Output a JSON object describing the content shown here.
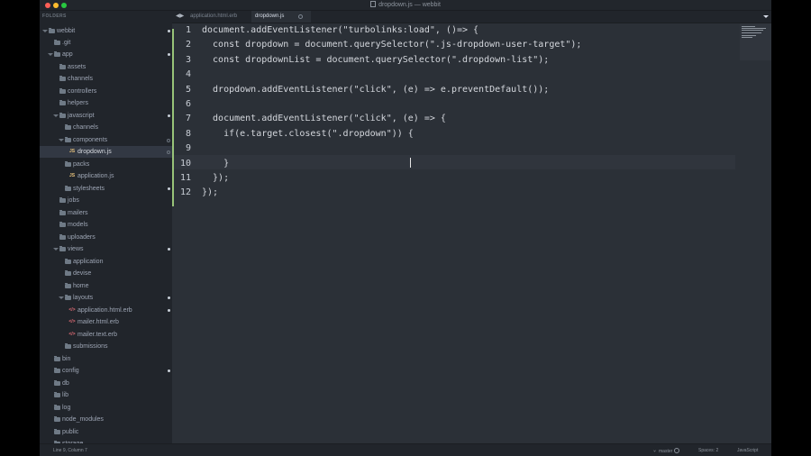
{
  "window": {
    "title": "dropdown.js — webbit"
  },
  "sidebar": {
    "header": "FOLDERS",
    "items": [
      {
        "label": "webbit",
        "type": "folder"
      },
      {
        "label": ".git",
        "type": "folder"
      },
      {
        "label": "app",
        "type": "folder"
      },
      {
        "label": "assets",
        "type": "folder"
      },
      {
        "label": "channels",
        "type": "folder"
      },
      {
        "label": "controllers",
        "type": "folder"
      },
      {
        "label": "helpers",
        "type": "folder"
      },
      {
        "label": "javascript",
        "type": "folder"
      },
      {
        "label": "channels",
        "type": "folder"
      },
      {
        "label": "components",
        "type": "folder"
      },
      {
        "label": "dropdown.js",
        "type": "js"
      },
      {
        "label": "packs",
        "type": "folder"
      },
      {
        "label": "application.js",
        "type": "js"
      },
      {
        "label": "stylesheets",
        "type": "folder"
      },
      {
        "label": "jobs",
        "type": "folder"
      },
      {
        "label": "mailers",
        "type": "folder"
      },
      {
        "label": "models",
        "type": "folder"
      },
      {
        "label": "uploaders",
        "type": "folder"
      },
      {
        "label": "views",
        "type": "folder"
      },
      {
        "label": "application",
        "type": "folder"
      },
      {
        "label": "devise",
        "type": "folder"
      },
      {
        "label": "home",
        "type": "folder"
      },
      {
        "label": "layouts",
        "type": "folder"
      },
      {
        "label": "application.html.erb",
        "type": "erb"
      },
      {
        "label": "mailer.html.erb",
        "type": "erb"
      },
      {
        "label": "mailer.text.erb",
        "type": "erb"
      },
      {
        "label": "submissions",
        "type": "folder"
      },
      {
        "label": "bin",
        "type": "folder"
      },
      {
        "label": "config",
        "type": "folder"
      },
      {
        "label": "db",
        "type": "folder"
      },
      {
        "label": "lib",
        "type": "folder"
      },
      {
        "label": "log",
        "type": "folder"
      },
      {
        "label": "node_modules",
        "type": "folder"
      },
      {
        "label": "public",
        "type": "folder"
      },
      {
        "label": "storage",
        "type": "folder"
      }
    ]
  },
  "tabs": [
    {
      "label": "application.html.erb",
      "active": false
    },
    {
      "label": "dropdown.js",
      "active": true
    }
  ],
  "icons": {
    "back": "back-arrow-icon",
    "forward": "forward-arrow-icon",
    "overflow": "chevron-down-icon",
    "branch": "branch-icon",
    "clean": "clean-icon"
  },
  "editor": {
    "line_numbers": [
      "1",
      "2",
      "3",
      "4",
      "5",
      "6",
      "7",
      "8",
      "9",
      "10",
      "11",
      "12"
    ],
    "lines": [
      "document.addEventListener(\"turbolinks:load\", ()=> {",
      "  const dropdown = document.querySelector(\".js-dropdown-user-target\");",
      "  const dropdownList = document.querySelector(\".dropdown-list\");",
      "",
      "  dropdown.addEventListener(\"click\", (e) => e.preventDefault());",
      "",
      "  document.addEventListener(\"click\", (e) => {",
      "    if(e.target.closest(\".dropdown\")) {",
      "",
      "    }",
      "  });",
      "});"
    ]
  },
  "statusbar": {
    "position": "Line 9, Column 7",
    "branch": "master",
    "spaces": "Spaces: 2",
    "syntax": "JavaScript"
  }
}
